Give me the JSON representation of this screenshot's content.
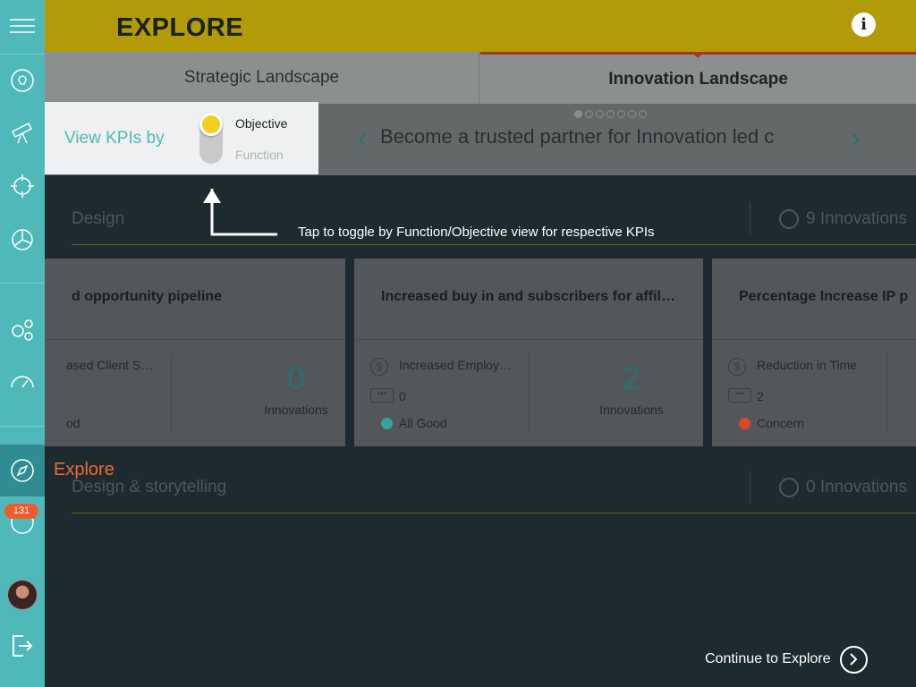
{
  "header": {
    "title": "EXPLORE",
    "info_icon": "i"
  },
  "tabs": [
    {
      "label": "Strategic Landscape"
    },
    {
      "label": "Innovation Landscape"
    }
  ],
  "objective_text": "Become a trusted partner for Innovation led c",
  "toggle": {
    "label": "View KPIs by",
    "option_active": "Objective",
    "option_inactive": "Function"
  },
  "hint": "Tap to toggle by Function/Objective view for respective KPIs",
  "sections": [
    {
      "name": "Design",
      "count": "9 Innovations"
    },
    {
      "name": "Design & storytelling",
      "count": "0 Innovations"
    }
  ],
  "cards": [
    {
      "title": "d opportunity pipeline",
      "kpi": "ased Client S…",
      "comments": "",
      "status": "od",
      "status_color": "#35a39b",
      "innovations": "0",
      "innovations_label": "Innovations"
    },
    {
      "title": "Increased buy in and subscribers for affil…",
      "kpi": "Increased Employ…",
      "comments": "0",
      "status": "All Good",
      "status_color": "#35a39b",
      "innovations": "2",
      "innovations_label": "Innovations"
    },
    {
      "title": "Percentage Increase IP p",
      "kpi": "Reduction in Time",
      "comments": "2",
      "status": "Concern",
      "status_color": "#e0442a",
      "innovations": "",
      "innovations_label": ""
    }
  ],
  "sidebar": {
    "active_label": "Explore",
    "badge": "131"
  },
  "continue_label": "Continue to Explore",
  "colors": {
    "accent_teal": "#4fb9ba",
    "header_gold": "#b29a08",
    "explore_orange": "#f26a31"
  }
}
